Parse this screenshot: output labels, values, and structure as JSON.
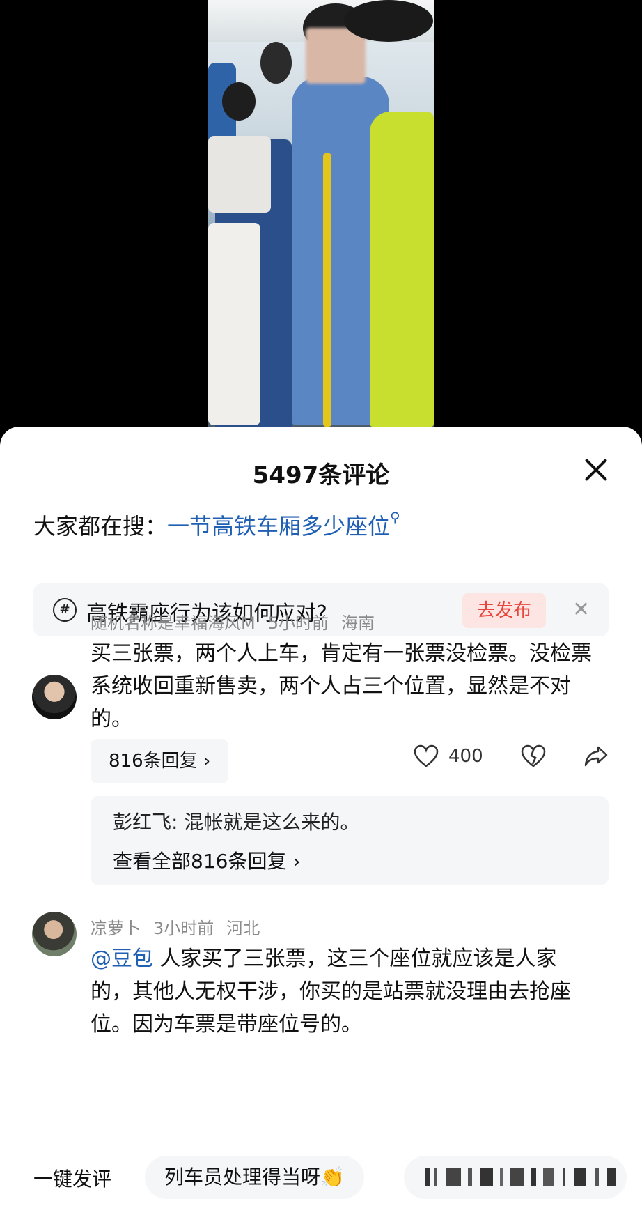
{
  "sheet": {
    "title": "5497条评论",
    "search_label": "大家都在搜：",
    "search_keyword": "一节高铁车厢多少座位",
    "topic_text": "高铁霸座行为该如何应对?",
    "topic_button": "去发布"
  },
  "comments": [
    {
      "user": "随机名称是幸福海风M",
      "time": "5小时前",
      "location": "海南",
      "text": "买三张票，两个人上车，肯定有一张票没检票。没检票系统收回重新售卖，两个人占三个位置，显然是不对的。",
      "replies_label": "816条回复 ›",
      "likes": "400",
      "top_reply": "彭红飞: 混帐就是这么来的。",
      "view_all": "查看全部816条回复 ›"
    },
    {
      "user": "凉萝卜",
      "time": "3小时前",
      "location": "河北",
      "mention": "@豆包",
      "text": " 人家买了三张票，这三个座位就应该是人家的，其他人无权干涉，你买的是站票就没理由去抢座位。因为车票是带座位号的。"
    }
  ],
  "bottom": {
    "quick_label": "一键发评",
    "chip_1": "列车员处理得当呀👏"
  },
  "colors": {
    "link": "#1f5fb4",
    "publish_bg": "#fde5e3",
    "publish_text": "#e8463c"
  }
}
